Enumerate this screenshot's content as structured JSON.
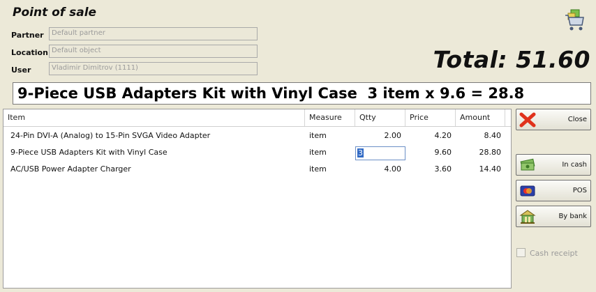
{
  "window": {
    "title": "Point of sale"
  },
  "form": {
    "partner": {
      "label": "Partner",
      "value": "Default partner"
    },
    "location": {
      "label": "Location",
      "value": "Default object"
    },
    "user": {
      "label": "User",
      "value": "Vladimir Dimitrov (1111)"
    }
  },
  "total": {
    "text": "Total: 51.60"
  },
  "current_line": "9-Piece USB Adapters Kit with Vinyl Case  3 item x 9.6 = 28.8",
  "table": {
    "columns": [
      "Item",
      "Measure",
      "Qtty",
      "Price",
      "Amount"
    ],
    "rows": [
      {
        "item": "24-Pin DVI-A (Analog) to 15-Pin SVGA Video Adapter",
        "measure": "item",
        "qtty": "2.00",
        "price": "4.20",
        "amount": "8.40"
      },
      {
        "item": "9-Piece USB Adapters Kit with Vinyl Case",
        "measure": "item",
        "qtty": "3",
        "price": "9.60",
        "amount": "28.80"
      },
      {
        "item": "AC/USB Power Adapter Charger",
        "measure": "item",
        "qtty": "4.00",
        "price": "3.60",
        "amount": "14.40"
      }
    ]
  },
  "buttons": {
    "close": "Close",
    "in_cash": "In cash",
    "pos": "POS",
    "by_bank": "By bank"
  },
  "cash_receipt": {
    "label": "Cash receipt",
    "checked": false
  },
  "icons": {
    "cart": "shopping-cart-icon",
    "close": "red-x-icon",
    "cash": "banknotes-icon",
    "pos": "card-icon",
    "bank": "bank-icon"
  }
}
